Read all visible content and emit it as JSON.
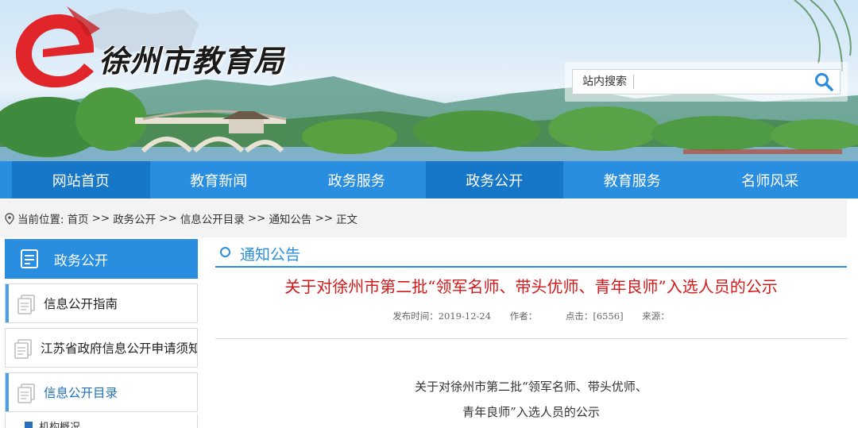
{
  "header": {
    "logo_text": "徐州市教育局",
    "search_label": "站内搜索",
    "search_value": "",
    "search_icon": "search-icon"
  },
  "nav": {
    "items": [
      {
        "label": "网站首页"
      },
      {
        "label": "教育新闻"
      },
      {
        "label": "政务服务"
      },
      {
        "label": "政务公开"
      },
      {
        "label": "教育服务"
      },
      {
        "label": "名师风采"
      }
    ]
  },
  "breadcrumb": {
    "prefix": "当前位置:",
    "items": [
      "首页",
      "政务公开",
      "信息公开目录",
      "通知公告",
      "正文"
    ],
    "separator": ">>"
  },
  "sidebar": {
    "title": "政务公开",
    "items": [
      {
        "label": "信息公开指南"
      },
      {
        "label": "江苏省政府信息公开申请须知"
      },
      {
        "label": "信息公开目录"
      }
    ],
    "sub_item": "机构概况"
  },
  "content": {
    "section_title": "通知公告",
    "article_title": "关于对徐州市第二批“领军名师、带头优师、青年良师”入选人员的公示",
    "meta": {
      "publish": "发布时间：2019-12-24",
      "author": "作者：",
      "clicks": "点击：[6556]",
      "source": "来源："
    },
    "body_lines": [
      "关于对徐州市第二批“领军名师、带头优师、",
      "青年良师”入选人员的公示"
    ]
  },
  "colors": {
    "nav_blue": "#2a8ee0",
    "nav_active": "#1677c9",
    "title_red": "#d3181a"
  }
}
